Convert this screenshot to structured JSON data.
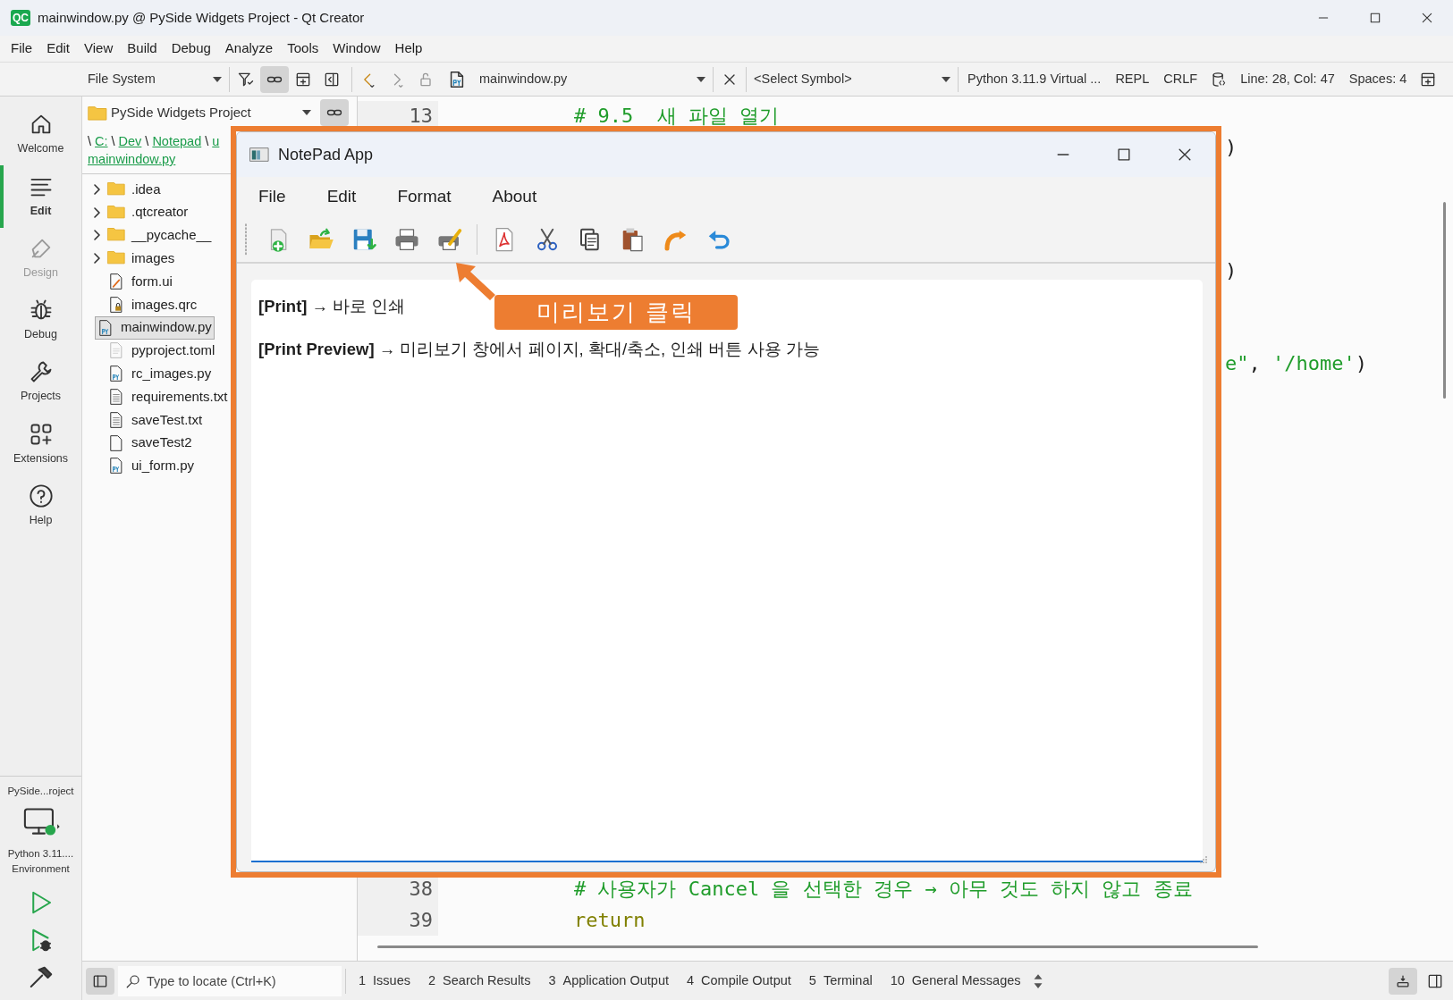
{
  "window": {
    "badge": "QC",
    "title": "mainwindow.py @ PySide Widgets Project - Qt Creator"
  },
  "menu": [
    "File",
    "Edit",
    "View",
    "Build",
    "Debug",
    "Analyze",
    "Tools",
    "Window",
    "Help"
  ],
  "toolbar": {
    "sidebar_view": "File System",
    "synchronize": true,
    "open_document": "mainwindow.py",
    "symbol": "<Select Symbol>",
    "interpreter": "Python 3.11.9 Virtual ...",
    "repl": "REPL",
    "line_ending": "CRLF",
    "position": "Line: 28, Col: 47",
    "indentation": "Spaces: 4"
  },
  "modes": [
    {
      "label": "Welcome",
      "selected": false,
      "disabled": false
    },
    {
      "label": "Edit",
      "selected": true,
      "disabled": false
    },
    {
      "label": "Design",
      "selected": false,
      "disabled": true
    },
    {
      "label": "Debug",
      "selected": false,
      "disabled": false
    },
    {
      "label": "Projects",
      "selected": false,
      "disabled": false
    },
    {
      "label": "Extensions",
      "selected": false,
      "disabled": false
    },
    {
      "label": "Help",
      "selected": false,
      "disabled": false
    }
  ],
  "kit": {
    "project": "PySide...roject",
    "lines": [
      "Python 3.11....",
      "Environment"
    ]
  },
  "project_tree": {
    "project": "PySide Widgets Project",
    "synchronize": true,
    "path_lines": [
      [
        {
          "text": "\\",
          "kind": "separator"
        },
        {
          "text": "C:",
          "kind": "link"
        },
        {
          "text": "\\",
          "kind": "separator"
        },
        {
          "text": "Dev",
          "kind": "link"
        },
        {
          "text": "\\",
          "kind": "separator"
        },
        {
          "text": "Notepad",
          "kind": "link"
        },
        {
          "text": "\\",
          "kind": "separator"
        },
        {
          "text": "u",
          "kind": "link"
        }
      ],
      [
        {
          "text": "mainwindow.py",
          "kind": "link"
        }
      ]
    ],
    "items": [
      {
        "name": ".idea",
        "kind": "folder",
        "expanded": false,
        "selected": false
      },
      {
        "name": ".qtcreator",
        "kind": "folder",
        "expanded": false,
        "selected": false
      },
      {
        "name": "__pycache__",
        "kind": "folder",
        "expanded": false,
        "selected": false
      },
      {
        "name": "images",
        "kind": "folder",
        "expanded": false,
        "selected": false
      },
      {
        "name": "form.ui",
        "kind": "ui",
        "selected": false
      },
      {
        "name": "images.qrc",
        "kind": "resource",
        "selected": false
      },
      {
        "name": "mainwindow.py",
        "kind": "python",
        "selected": true
      },
      {
        "name": "pyproject.toml",
        "kind": "config",
        "selected": false
      },
      {
        "name": "rc_images.py",
        "kind": "python",
        "selected": false
      },
      {
        "name": "requirements.txt",
        "kind": "text",
        "selected": false
      },
      {
        "name": "saveTest.txt",
        "kind": "text",
        "selected": false
      },
      {
        "name": "saveTest2",
        "kind": "plain",
        "selected": false
      },
      {
        "name": "ui_form.py",
        "kind": "python",
        "selected": false
      }
    ]
  },
  "editor": {
    "lines": [
      {
        "number": "13",
        "tokens": [
          {
            "text": "# 9.5  새 파일 열기",
            "kind": "comment"
          }
        ]
      },
      {
        "tail": [
          {
            "text": ")",
            "kind": "plain"
          }
        ]
      },
      {
        "tail": [
          {
            "text": ")",
            "kind": "plain"
          }
        ]
      },
      {
        "tail": [
          {
            "text": "e\"",
            "kind": "string"
          },
          {
            "text": ", ",
            "kind": "plain"
          },
          {
            "text": "'/home'",
            "kind": "string"
          },
          {
            "text": ")",
            "kind": "plain"
          }
        ]
      },
      {
        "number": "38",
        "tokens": [
          {
            "text": "# 사용자가 Cancel 을 선택한 경우 → 아무 것도 하지 않고 종료",
            "kind": "comment"
          }
        ]
      },
      {
        "number": "39",
        "tokens": [
          {
            "text": "return",
            "kind": "keyword"
          }
        ]
      }
    ]
  },
  "locator": {
    "placeholder": "Type to locate (Ctrl+K)"
  },
  "output_panes": [
    {
      "number": "1",
      "label": "Issues"
    },
    {
      "number": "2",
      "label": "Search Results"
    },
    {
      "number": "3",
      "label": "Application Output"
    },
    {
      "number": "4",
      "label": "Compile Output"
    },
    {
      "number": "5",
      "label": "Terminal"
    },
    {
      "number": "10",
      "label": "General Messages"
    }
  ],
  "notepad": {
    "title": "NotePad App",
    "menu": [
      "File",
      "Edit",
      "Format",
      "About"
    ],
    "text_lines": [
      "**[Print]** → 바로 인쇄",
      "**[Print Preview]** → 미리보기 창에서 페이지, 확대/축소, 인쇄 버튼 사용 가능"
    ]
  },
  "annotation": {
    "text": "미리보기 클릭"
  }
}
